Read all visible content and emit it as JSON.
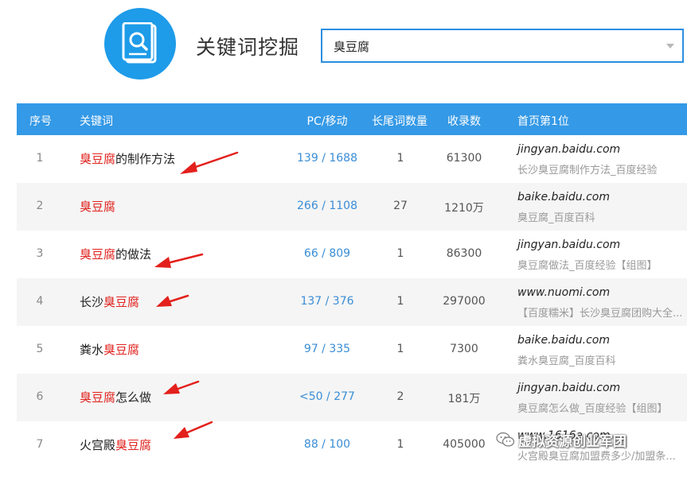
{
  "header": {
    "title": "关键词挖掘",
    "search_value": "臭豆腐"
  },
  "table": {
    "columns": [
      "序号",
      "关键词",
      "PC/移动",
      "长尾词数量",
      "收录数",
      "首页第1位"
    ],
    "rows": [
      {
        "num": "1",
        "kw_parts": [
          {
            "text": "臭豆腐",
            "hl": true
          },
          {
            "text": "的制作方法",
            "hl": false
          }
        ],
        "pc": "139 / 1688",
        "longtail": "1",
        "count": "61300",
        "site": "jingyan.baidu.com",
        "desc": "长沙臭豆腐制作方法_百度经验"
      },
      {
        "num": "2",
        "kw_parts": [
          {
            "text": "臭豆腐",
            "hl": true
          }
        ],
        "pc": "266 / 1108",
        "longtail": "27",
        "count": "1210万",
        "site": "baike.baidu.com",
        "desc": "臭豆腐_百度百科"
      },
      {
        "num": "3",
        "kw_parts": [
          {
            "text": "臭豆腐",
            "hl": true
          },
          {
            "text": "的做法",
            "hl": false
          }
        ],
        "pc": "66 / 809",
        "longtail": "1",
        "count": "86300",
        "site": "jingyan.baidu.com",
        "desc": "臭豆腐做法_百度经验【组图】"
      },
      {
        "num": "4",
        "kw_parts": [
          {
            "text": "长沙",
            "hl": false
          },
          {
            "text": "臭豆腐",
            "hl": true
          }
        ],
        "pc": "137 / 376",
        "longtail": "1",
        "count": "297000",
        "site": "www.nuomi.com",
        "desc": "【百度糯米】长沙臭豆腐团购大全..."
      },
      {
        "num": "5",
        "kw_parts": [
          {
            "text": "粪水",
            "hl": false
          },
          {
            "text": "臭豆腐",
            "hl": true
          }
        ],
        "pc": "97 / 335",
        "longtail": "1",
        "count": "7300",
        "site": "baike.baidu.com",
        "desc": "粪水臭豆腐_百度百科"
      },
      {
        "num": "6",
        "kw_parts": [
          {
            "text": "臭豆腐",
            "hl": true
          },
          {
            "text": "怎么做",
            "hl": false
          }
        ],
        "pc": "<50 / 277",
        "longtail": "2",
        "count": "181万",
        "site": "jingyan.baidu.com",
        "desc": "臭豆腐怎么做_百度经验【组图】"
      },
      {
        "num": "7",
        "kw_parts": [
          {
            "text": "火宫殿",
            "hl": false
          },
          {
            "text": "臭豆腐",
            "hl": true
          }
        ],
        "pc": "88 / 100",
        "longtail": "1",
        "count": "405000",
        "site": "www.1616a.com",
        "desc": "火宫殿臭豆腐加盟费多少/加盟条..."
      }
    ]
  },
  "watermark": {
    "text": "虚拟资源创业军团"
  },
  "colors": {
    "header_bg": "#3499e6",
    "logo_bg": "#1e9be9",
    "highlight": "#e0231e",
    "link_blue": "#3a8dd6",
    "arrow_red": "#e3201c"
  },
  "icons": {
    "logo": "search-document-icon",
    "dropdown": "chevron-down-icon",
    "watermark": "wechat-icon"
  }
}
